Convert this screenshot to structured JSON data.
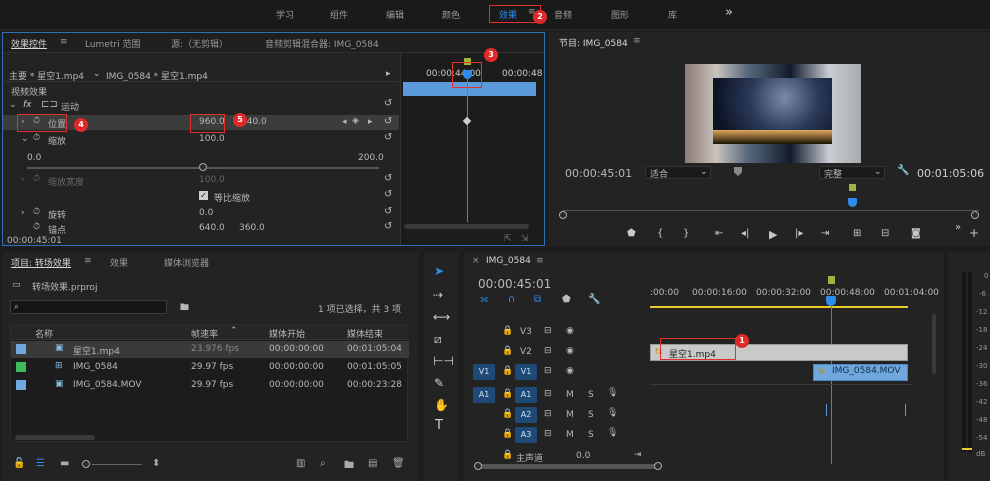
{
  "top_menu": {
    "items": [
      "学习",
      "组件",
      "编辑",
      "颜色",
      "效果",
      "音频",
      "图形",
      "库"
    ],
    "active": "效果",
    "more": "»"
  },
  "effect_controls": {
    "tabs": [
      "效果控件",
      "Lumetri 范围",
      "源:（无剪辑）",
      "音频剪辑混合器: IMG_0584"
    ],
    "tab_menu": "≡",
    "master": "主要 * 星空1.mp4",
    "clip": "IMG_0584 * 星空1.mp4",
    "timecode_ruler": "00:00:44:00",
    "timecode_ruler2": "00:00:48",
    "section": "视频效果",
    "fx_label": "fx",
    "motion": "运动",
    "position_label": "位置",
    "position_x": "960.0",
    "position_y": "540.0",
    "scale_label": "缩放",
    "scale_value": "100.0",
    "scale_min": "0.0",
    "scale_max": "200.0",
    "scale_width_label": "缩放宽度",
    "scale_width_value": "100.0",
    "uniform_scale": "等比缩放",
    "rotation_label": "旋转",
    "rotation_value": "0.0",
    "anchor_label": "锚点",
    "anchor_x": "640.0",
    "anchor_y": "360.0",
    "timecode": "00:00:45:01"
  },
  "program": {
    "title": "节目: IMG_0584",
    "menu": "≡",
    "timecode": "00:00:45:01",
    "fit": "适合",
    "quality": "完整",
    "duration": "00:01:05:06"
  },
  "project": {
    "tabs": [
      "项目: 转场效果",
      "效果",
      "媒体浏览器"
    ],
    "menu": "≡",
    "file": "转场效果.prproj",
    "status": "1 项已选择，共 3 项",
    "columns": [
      "名称",
      "帧速率",
      "媒体开始",
      "媒体结束"
    ],
    "rows": [
      {
        "name": "星空1.mp4",
        "fps": "23.976 fps",
        "start": "00:00:00:00",
        "end": "00:01:05:04",
        "color": "#6fa8dc"
      },
      {
        "name": "IMG_0584",
        "fps": "29.97 fps",
        "start": "00:00:00:00",
        "end": "00:01:05:05",
        "color": "#3dbb5a"
      },
      {
        "name": "IMG_0584.MOV",
        "fps": "29.97 fps",
        "start": "00:00:00:00",
        "end": "00:00:23:28",
        "color": "#6fa8dc"
      }
    ]
  },
  "timeline": {
    "title": "IMG_0584",
    "menu": "≡",
    "timecode": "00:00:45:01",
    "ruler": [
      ":00:00",
      "00:00:16:00",
      "00:00:32:00",
      "00:00:48:00",
      "00:01:04:00"
    ],
    "video_tracks": [
      "V3",
      "V2",
      "V1"
    ],
    "audio_tracks": [
      "A1",
      "A2",
      "A3"
    ],
    "src_v1": "V1",
    "src_a1": "A1",
    "clip_v2": "星空1.mp4",
    "clip_v1": "IMG_0584.MOV",
    "master": "主声道",
    "master_value": "0.0",
    "m": "M",
    "s": "S"
  },
  "meter": {
    "labels": [
      "0",
      "-6",
      "-12",
      "-18",
      "-24",
      "-30",
      "-36",
      "-42",
      "-48",
      "-54",
      "dB"
    ]
  },
  "callouts": [
    "1",
    "2",
    "3",
    "4",
    "5"
  ]
}
